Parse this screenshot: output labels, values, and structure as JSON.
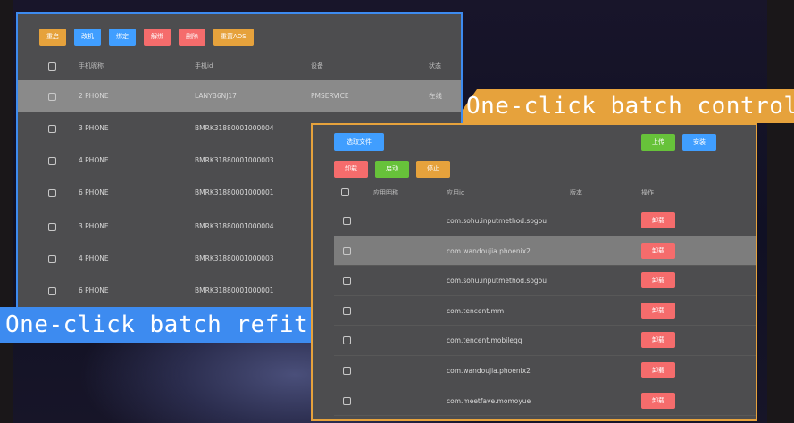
{
  "left_panel": {
    "toolbar": [
      "重启",
      "改机",
      "绑定",
      "解绑",
      "删除",
      "重置ADS"
    ],
    "columns": {
      "name": "手机昵称",
      "id": "手机id",
      "device": "设备",
      "status": "状态"
    },
    "rows": [
      {
        "name": "2 PHONE",
        "id": "LANYB6NJ17",
        "device": "PMSERVICE",
        "status": "在线"
      },
      {
        "name": "3 PHONE",
        "id": "BMRK31880001000004",
        "device": "",
        "status": ""
      },
      {
        "name": "4 PHONE",
        "id": "BMRK31880001000003",
        "device": "",
        "status": ""
      },
      {
        "name": "6 PHONE",
        "id": "BMRK31880001000001",
        "device": "",
        "status": ""
      },
      {
        "name": "3 PHONE",
        "id": "BMRK31880001000004",
        "device": "",
        "status": ""
      },
      {
        "name": "4 PHONE",
        "id": "BMRK31880001000003",
        "device": "",
        "status": ""
      },
      {
        "name": "6 PHONE",
        "id": "BMRK31880001000001",
        "device": "",
        "status": ""
      }
    ]
  },
  "callout_right": "One-click batch control",
  "callout_left": "One-click batch refit",
  "right_panel": {
    "select_file": "选取文件",
    "upload": "上传",
    "install": "安装",
    "actions": [
      "卸载",
      "启动",
      "停止"
    ],
    "columns": {
      "name": "应用明称",
      "id": "应用id",
      "version": "版本",
      "op": "操作"
    },
    "uninstall_label": "卸载",
    "rows": [
      {
        "id": "com.sohu.inputmethod.sogou"
      },
      {
        "id": "com.wandoujia.phoenix2"
      },
      {
        "id": "com.sohu.inputmethod.sogou"
      },
      {
        "id": "com.tencent.mm"
      },
      {
        "id": "com.tencent.mobileqq"
      },
      {
        "id": "com.wandoujia.phoenix2"
      },
      {
        "id": "com.meetfave.momoyue"
      }
    ]
  },
  "colors": {
    "accent_blue": "#3d8bf0",
    "accent_orange": "#e6a23c",
    "danger": "#f56c6c",
    "success": "#67c23a"
  }
}
